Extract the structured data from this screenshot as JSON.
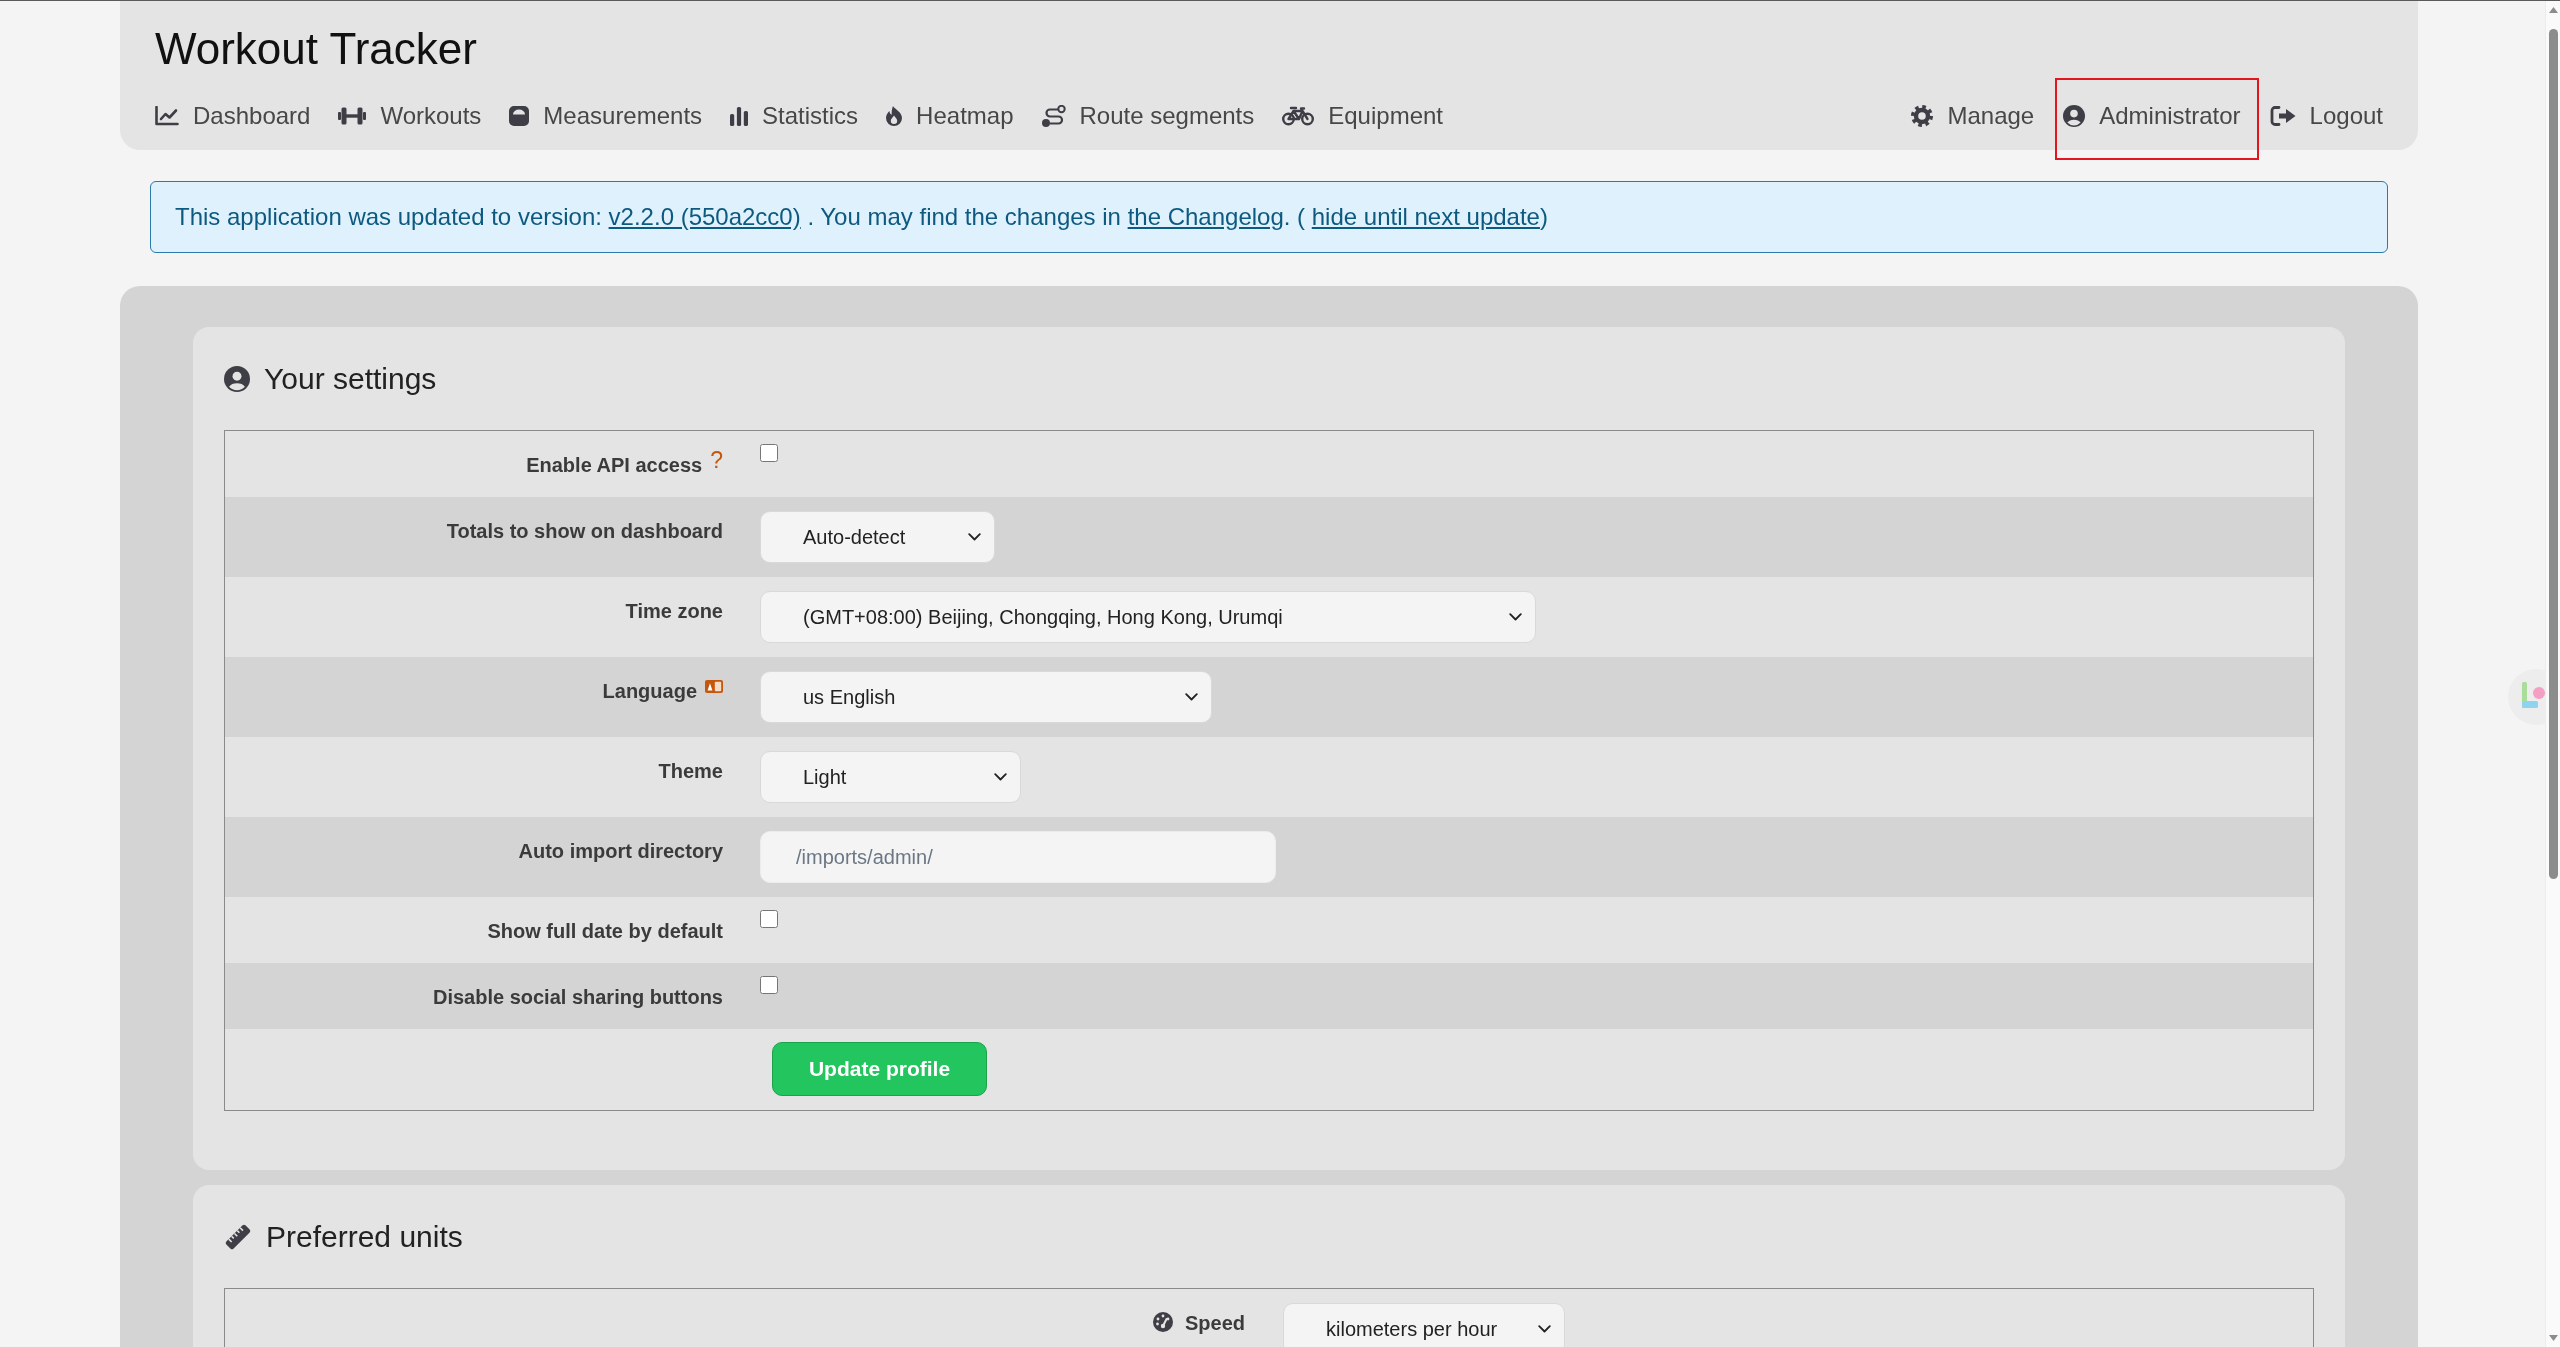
{
  "header": {
    "title": "Workout Tracker",
    "nav_left": [
      {
        "label": "Dashboard"
      },
      {
        "label": "Workouts"
      },
      {
        "label": "Measurements"
      },
      {
        "label": "Statistics"
      },
      {
        "label": "Heatmap"
      },
      {
        "label": "Route segments"
      },
      {
        "label": "Equipment"
      }
    ],
    "nav_right": [
      {
        "label": "Manage",
        "highlighted": false
      },
      {
        "label": "Administrator",
        "highlighted": true
      },
      {
        "label": "Logout",
        "highlighted": false
      }
    ]
  },
  "notice": {
    "parts": [
      {
        "kind": "text",
        "text": "This application was updated to version: "
      },
      {
        "kind": "link",
        "text": "v2.2.0 (550a2cc0)"
      },
      {
        "kind": "text",
        "text": " . You may find the changes in "
      },
      {
        "kind": "link",
        "text": "the Changelog"
      },
      {
        "kind": "text",
        "text": ". ( "
      },
      {
        "kind": "link",
        "text": "hide until next update"
      },
      {
        "kind": "text",
        "text": ")"
      }
    ]
  },
  "settings": {
    "title": "Your settings",
    "rows": [
      {
        "kind": "checkbox",
        "label": "Enable API access",
        "hint": "?",
        "checked": false
      },
      {
        "kind": "select",
        "label": "Totals to show on dashboard",
        "value": "Auto-detect"
      },
      {
        "kind": "select",
        "label": "Time zone",
        "value": "(GMT+08:00) Beijing, Chongqing, Hong Kong, Urumqi"
      },
      {
        "kind": "select",
        "label": "Language",
        "value": "us English"
      },
      {
        "kind": "select",
        "label": "Theme",
        "value": "Light"
      },
      {
        "kind": "input",
        "label": "Auto import directory",
        "placeholder": "/imports/admin/"
      },
      {
        "kind": "checkbox",
        "label": "Show full date by default",
        "checked": false
      },
      {
        "kind": "checkbox",
        "label": "Disable social sharing buttons",
        "checked": false
      },
      {
        "kind": "button",
        "label": "Update profile"
      }
    ]
  },
  "units": {
    "title": "Preferred units",
    "rows": [
      {
        "kind": "select",
        "label": "Speed",
        "value": "kilometers per hour"
      }
    ]
  }
}
